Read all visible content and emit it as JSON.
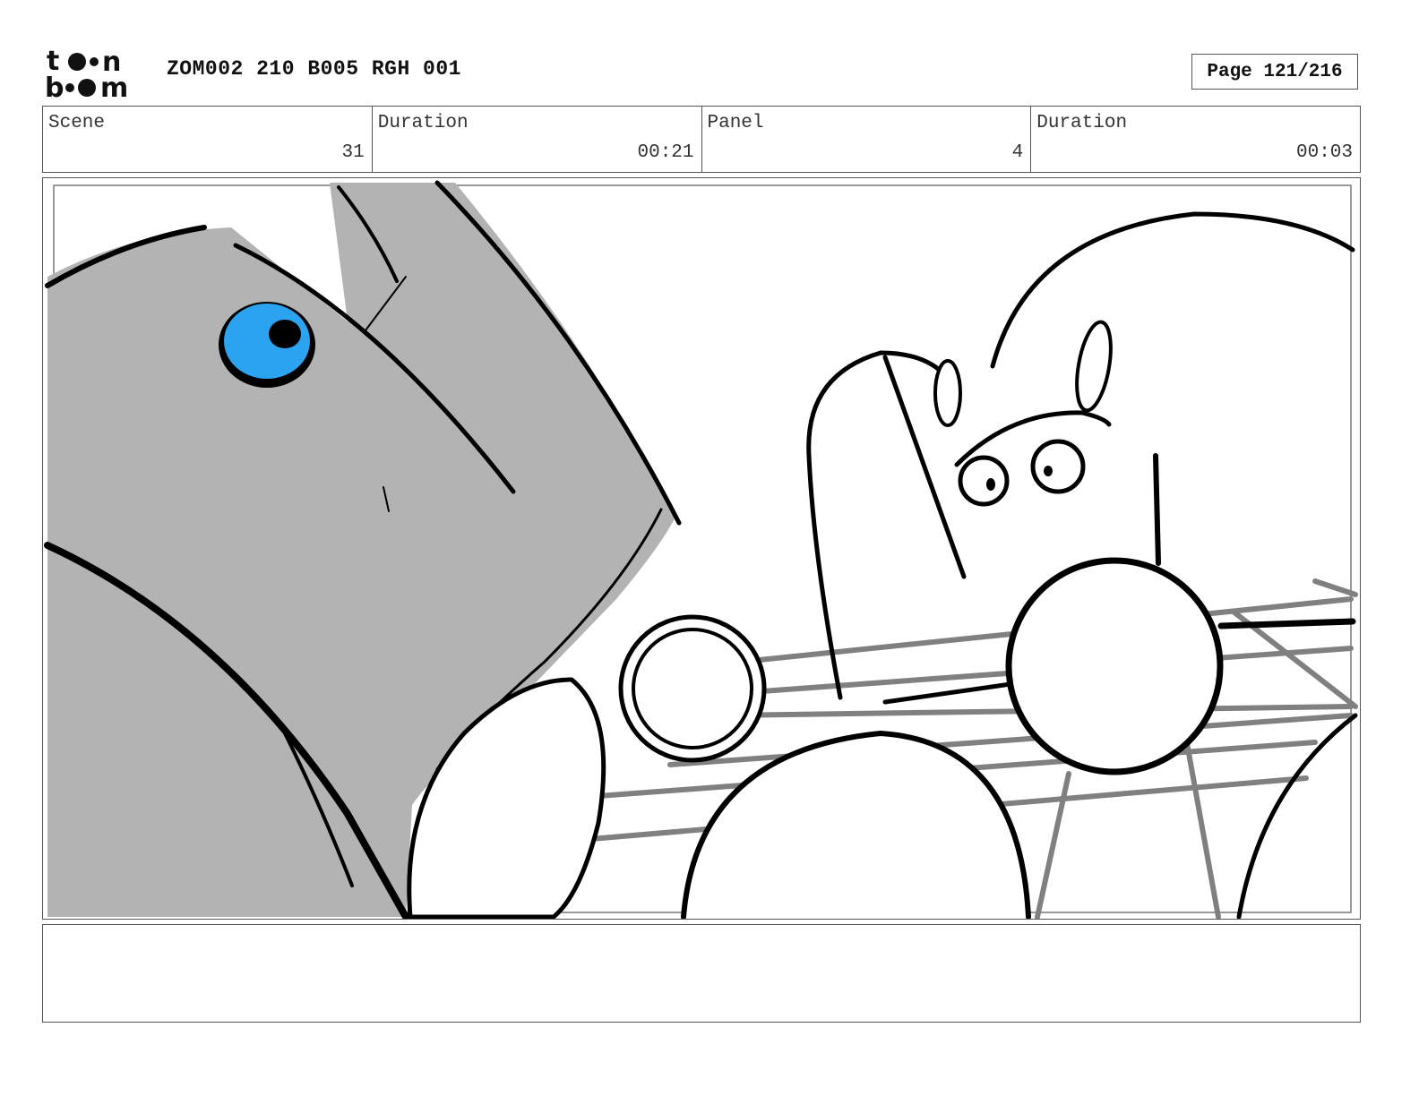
{
  "header": {
    "logo_text_top": "toon",
    "logo_text_bottom": "boom",
    "title": "ZOM002 210 B005 RGH 001",
    "page_label": "Page 121/216"
  },
  "info": {
    "scene_label": "Scene",
    "scene_value": "31",
    "scene_duration_label": "Duration",
    "scene_duration_value": "00:21",
    "panel_label": "Panel",
    "panel_value": "4",
    "panel_duration_label": "Duration",
    "panel_duration_value": "00:03"
  },
  "panel": {
    "drawing": "sketch",
    "colors": {
      "gray_fill": "#b3b3b3",
      "eye_blue": "#2ba3f0",
      "line": "#000000",
      "floor_line": "#808080"
    }
  },
  "notes": {
    "text": ""
  }
}
